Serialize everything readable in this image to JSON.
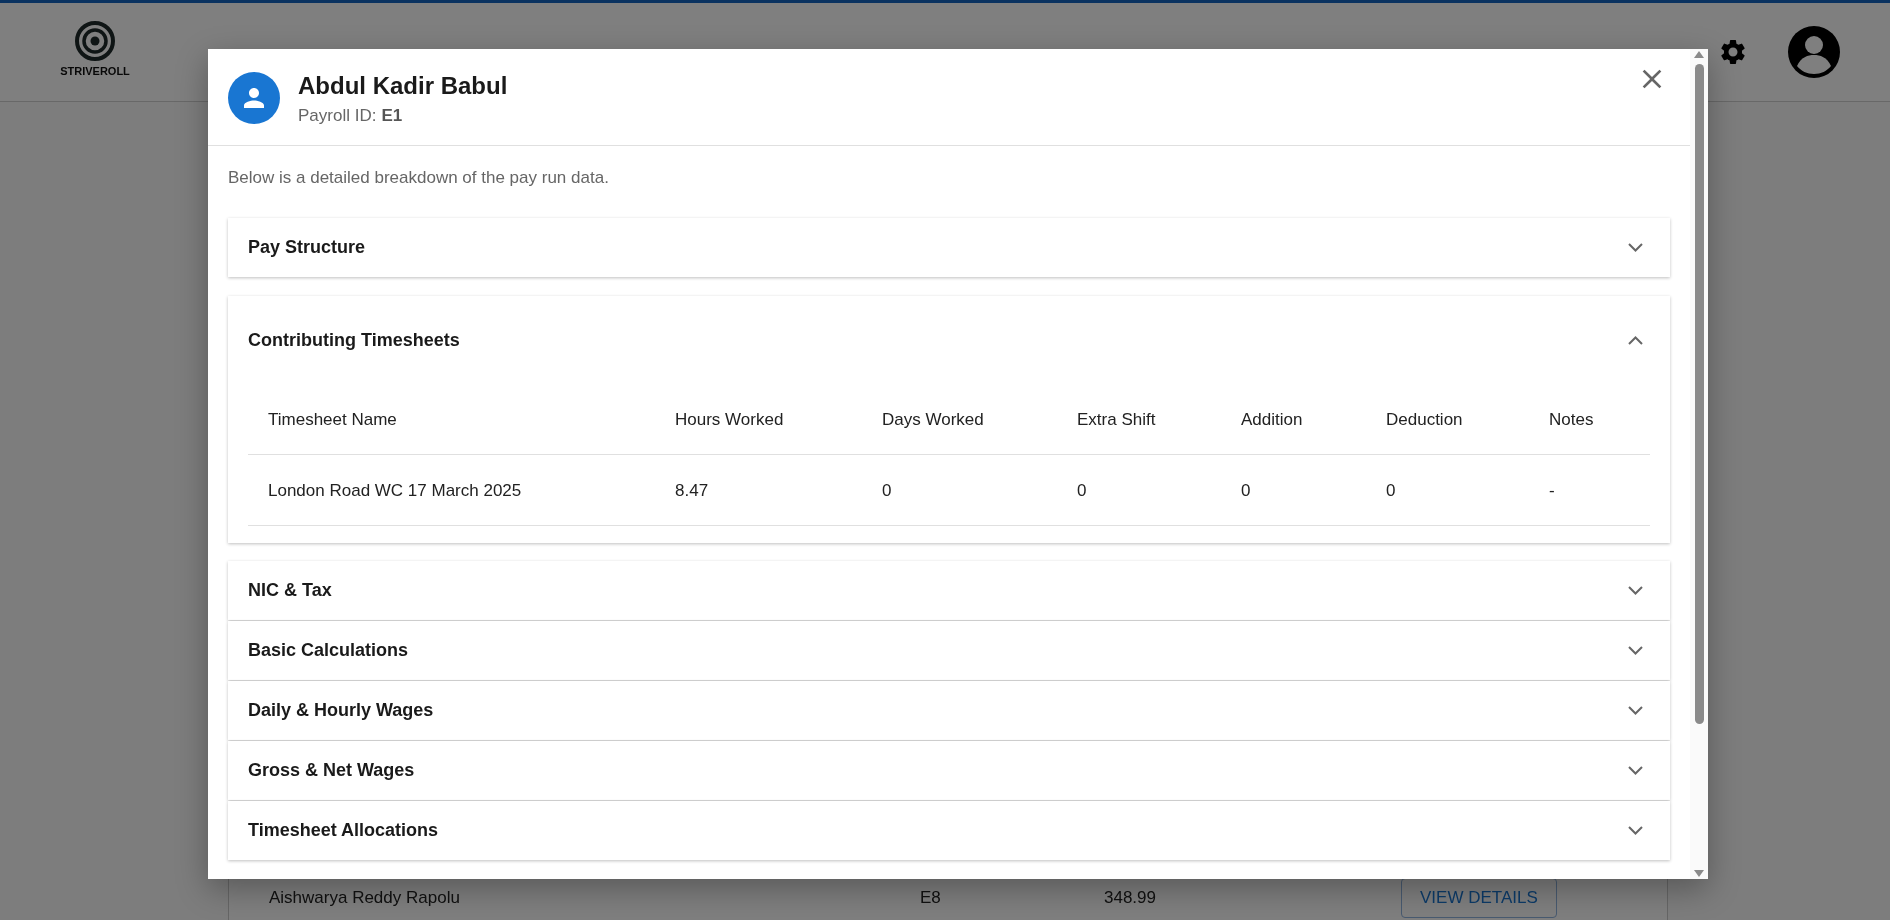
{
  "header": {
    "logo_text": "STRIVEROLL"
  },
  "modal": {
    "employee_name": "Abdul Kadir Babul",
    "payroll_id_label": "Payroll ID:",
    "payroll_id": "E1",
    "description": "Below is a detailed breakdown of the pay run data.",
    "sections": [
      {
        "title": "Pay Structure",
        "expanded": false
      },
      {
        "title": "Contributing Timesheets",
        "expanded": true,
        "table": {
          "columns": [
            "Timesheet Name",
            "Hours Worked",
            "Days Worked",
            "Extra Shift",
            "Addition",
            "Deduction",
            "Notes"
          ],
          "rows": [
            [
              "London Road WC 17 March 2025",
              "8.47",
              "0",
              "0",
              "0",
              "0",
              "-"
            ]
          ]
        }
      },
      {
        "title": "NIC & Tax",
        "expanded": false
      },
      {
        "title": "Basic Calculations",
        "expanded": false
      },
      {
        "title": "Daily & Hourly Wages",
        "expanded": false
      },
      {
        "title": "Gross & Net Wages",
        "expanded": false
      },
      {
        "title": "Timesheet Allocations",
        "expanded": false
      }
    ]
  },
  "background_table": {
    "rows": [
      {
        "name": "Aishwarya Reddy Rapolu",
        "payroll_id": "E8",
        "amount": "348.99",
        "action": "VIEW DETAILS"
      }
    ]
  }
}
